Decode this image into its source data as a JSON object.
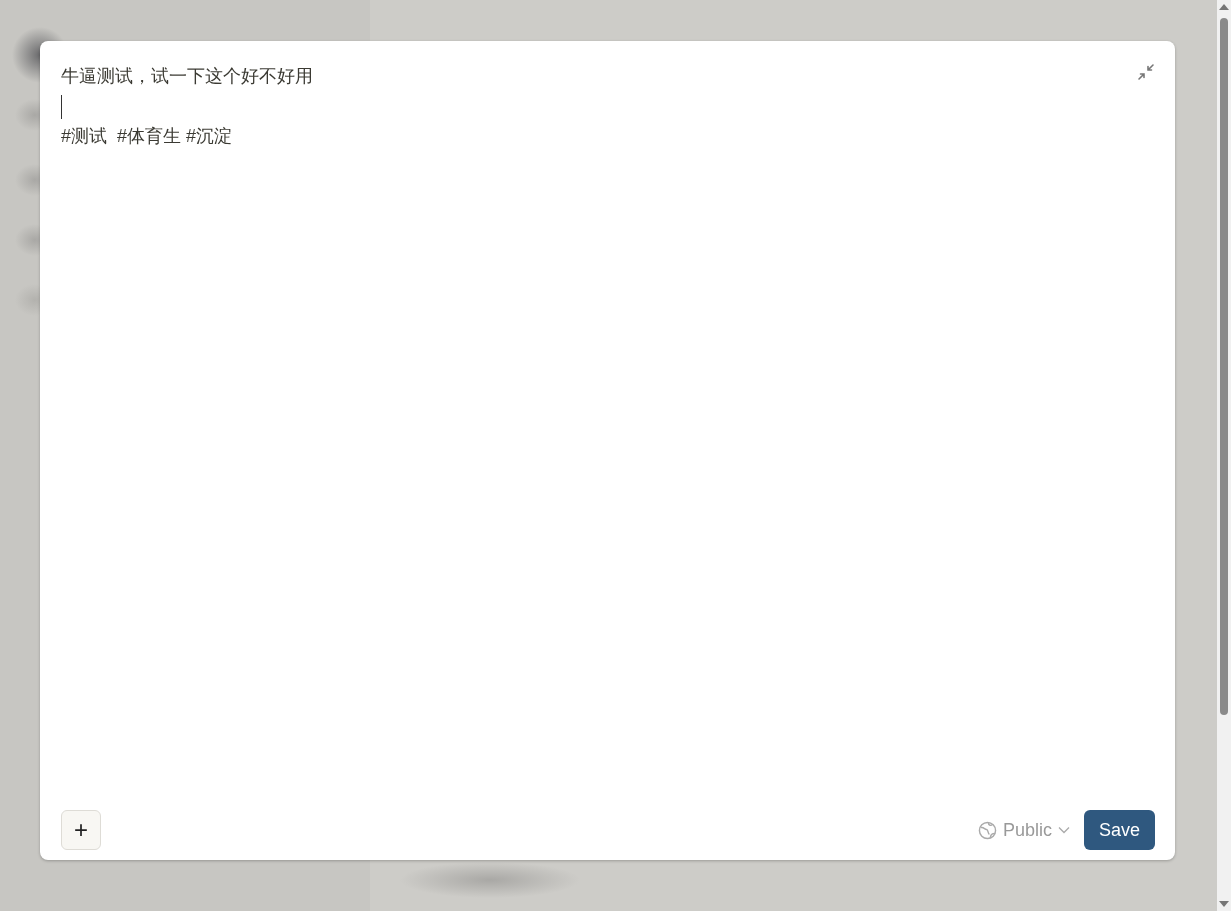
{
  "editor": {
    "lines": [
      {
        "kind": "text",
        "text": "牛逼测试，试一下这个好不好用"
      },
      {
        "kind": "cursor"
      },
      {
        "kind": "text",
        "text": "#测试  #体育生 #沉淀"
      }
    ]
  },
  "footer": {
    "add_button": "+",
    "visibility": "Public",
    "save_button": "Save"
  }
}
